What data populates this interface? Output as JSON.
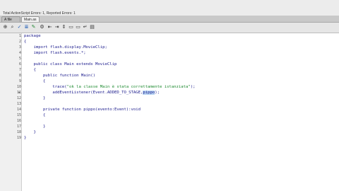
{
  "status": {
    "text": "Total ActionScript Errors: 1,  Reported Errors: 1"
  },
  "tabs": [
    {
      "label": "A file",
      "active": false
    },
    {
      "label": "Main.as",
      "active": true
    }
  ],
  "toolbar": {
    "icons": [
      "target-icon",
      "find-icon",
      "check-syntax-icon",
      "format-code-icon",
      "code-hint-icon",
      "debug-icon",
      "collapse-icon",
      "expand-icon",
      "collapse-all-icon",
      "comment-icon",
      "uncomment-icon",
      "wrap-icon",
      "help-icon"
    ]
  },
  "editor": {
    "lines": [
      {
        "n": "1",
        "text": "package"
      },
      {
        "n": "2",
        "text": "{"
      },
      {
        "n": "3",
        "text": "    import flash.display.MovieClip;"
      },
      {
        "n": "4",
        "text": "    import flash.events.*;"
      },
      {
        "n": "5",
        "text": ""
      },
      {
        "n": "6",
        "text": "    public class Main extends MovieClip"
      },
      {
        "n": "7",
        "text": "    {"
      },
      {
        "n": "8",
        "text": "        public function Main()"
      },
      {
        "n": "9",
        "text": "        {"
      },
      {
        "n": "10",
        "pre": "            trace(",
        "str": "\"ok la classe Main è stata correttamente istanziata\"",
        "post": ");"
      },
      {
        "n": "11",
        "pre": "            addEventListener(Event.ADDED_TO_STAGE,",
        "sel": "pippo",
        "post": ");"
      },
      {
        "n": "12",
        "text": "        }"
      },
      {
        "n": "13",
        "text": ""
      },
      {
        "n": "14",
        "text": "        private function pippo(evento:Event):void"
      },
      {
        "n": "15",
        "text": "        {"
      },
      {
        "n": "16",
        "text": ""
      },
      {
        "n": "17",
        "text": "        }"
      },
      {
        "n": "18",
        "text": "    }"
      },
      {
        "n": "19",
        "text": "}"
      }
    ]
  }
}
